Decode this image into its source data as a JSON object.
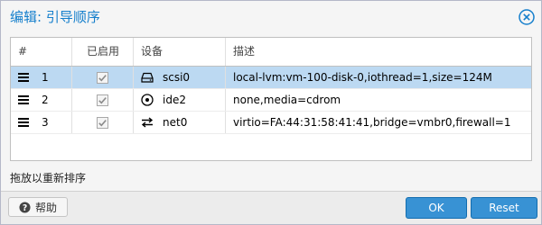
{
  "window": {
    "title": "编辑: 引导顺序",
    "close_icon": "close-icon"
  },
  "grid": {
    "columns": [
      "#",
      "已启用",
      "设备",
      "描述"
    ],
    "rows": [
      {
        "num": "1",
        "enabled": true,
        "device_icon": "hard-disk-icon",
        "device": "scsi0",
        "description": "local-lvm:vm-100-disk-0,iothread=1,size=124M",
        "selected": true
      },
      {
        "num": "2",
        "enabled": true,
        "device_icon": "cdrom-icon",
        "device": "ide2",
        "description": "none,media=cdrom",
        "selected": false
      },
      {
        "num": "3",
        "enabled": true,
        "device_icon": "network-icon",
        "device": "net0",
        "description": "virtio=FA:44:31:58:41:41,bridge=vmbr0,firewall=1",
        "selected": false
      }
    ]
  },
  "hint": "拖放以重新排序",
  "buttons": {
    "help": "帮助",
    "ok": "OK",
    "reset": "Reset"
  },
  "colors": {
    "accent": "#157fcc",
    "selected_row": "#bcd9f2",
    "primary_button": "#3892d4"
  }
}
